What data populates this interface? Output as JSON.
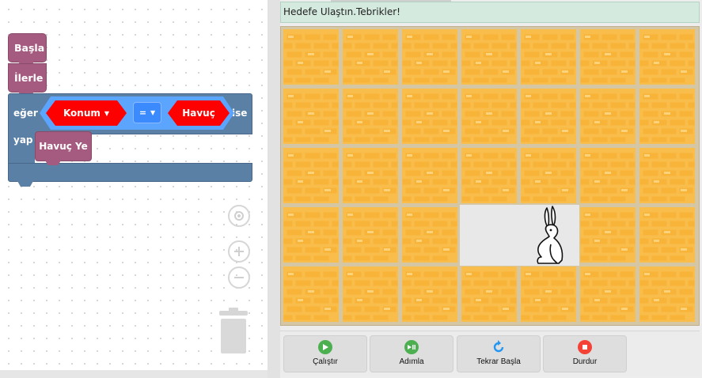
{
  "workspace": {
    "blocks": {
      "start_label": "Başla",
      "move_label": "İlerle",
      "if_label": "eğer",
      "then_label": "ise",
      "do_label": "yap",
      "condition_left": "Konum",
      "operator": "=",
      "condition_right": "Havuç",
      "action_label": "Havuç Ye"
    },
    "icons": [
      "target-icon",
      "zoom-in-icon",
      "zoom-out-icon",
      "trash-icon"
    ]
  },
  "game": {
    "message": "Hedefe Ulaştın.Tebrikler!",
    "grid_rows": 5,
    "grid_cols": 7,
    "colors": {
      "brick": "#f5b33a",
      "brick_light": "#fcc960",
      "mortar": "#d6c7a4",
      "goal_bg": "#e8e8e8",
      "message_bg": "#d4eadf"
    }
  },
  "controls": {
    "run_label": "Çalıştır",
    "step_label": "Adımla",
    "reset_label": "Tekrar Başla",
    "stop_label": "Durdur",
    "colors": {
      "run": "#4caf50",
      "step": "#4caf50",
      "reset": "#2196f3",
      "stop": "#f44336"
    }
  }
}
